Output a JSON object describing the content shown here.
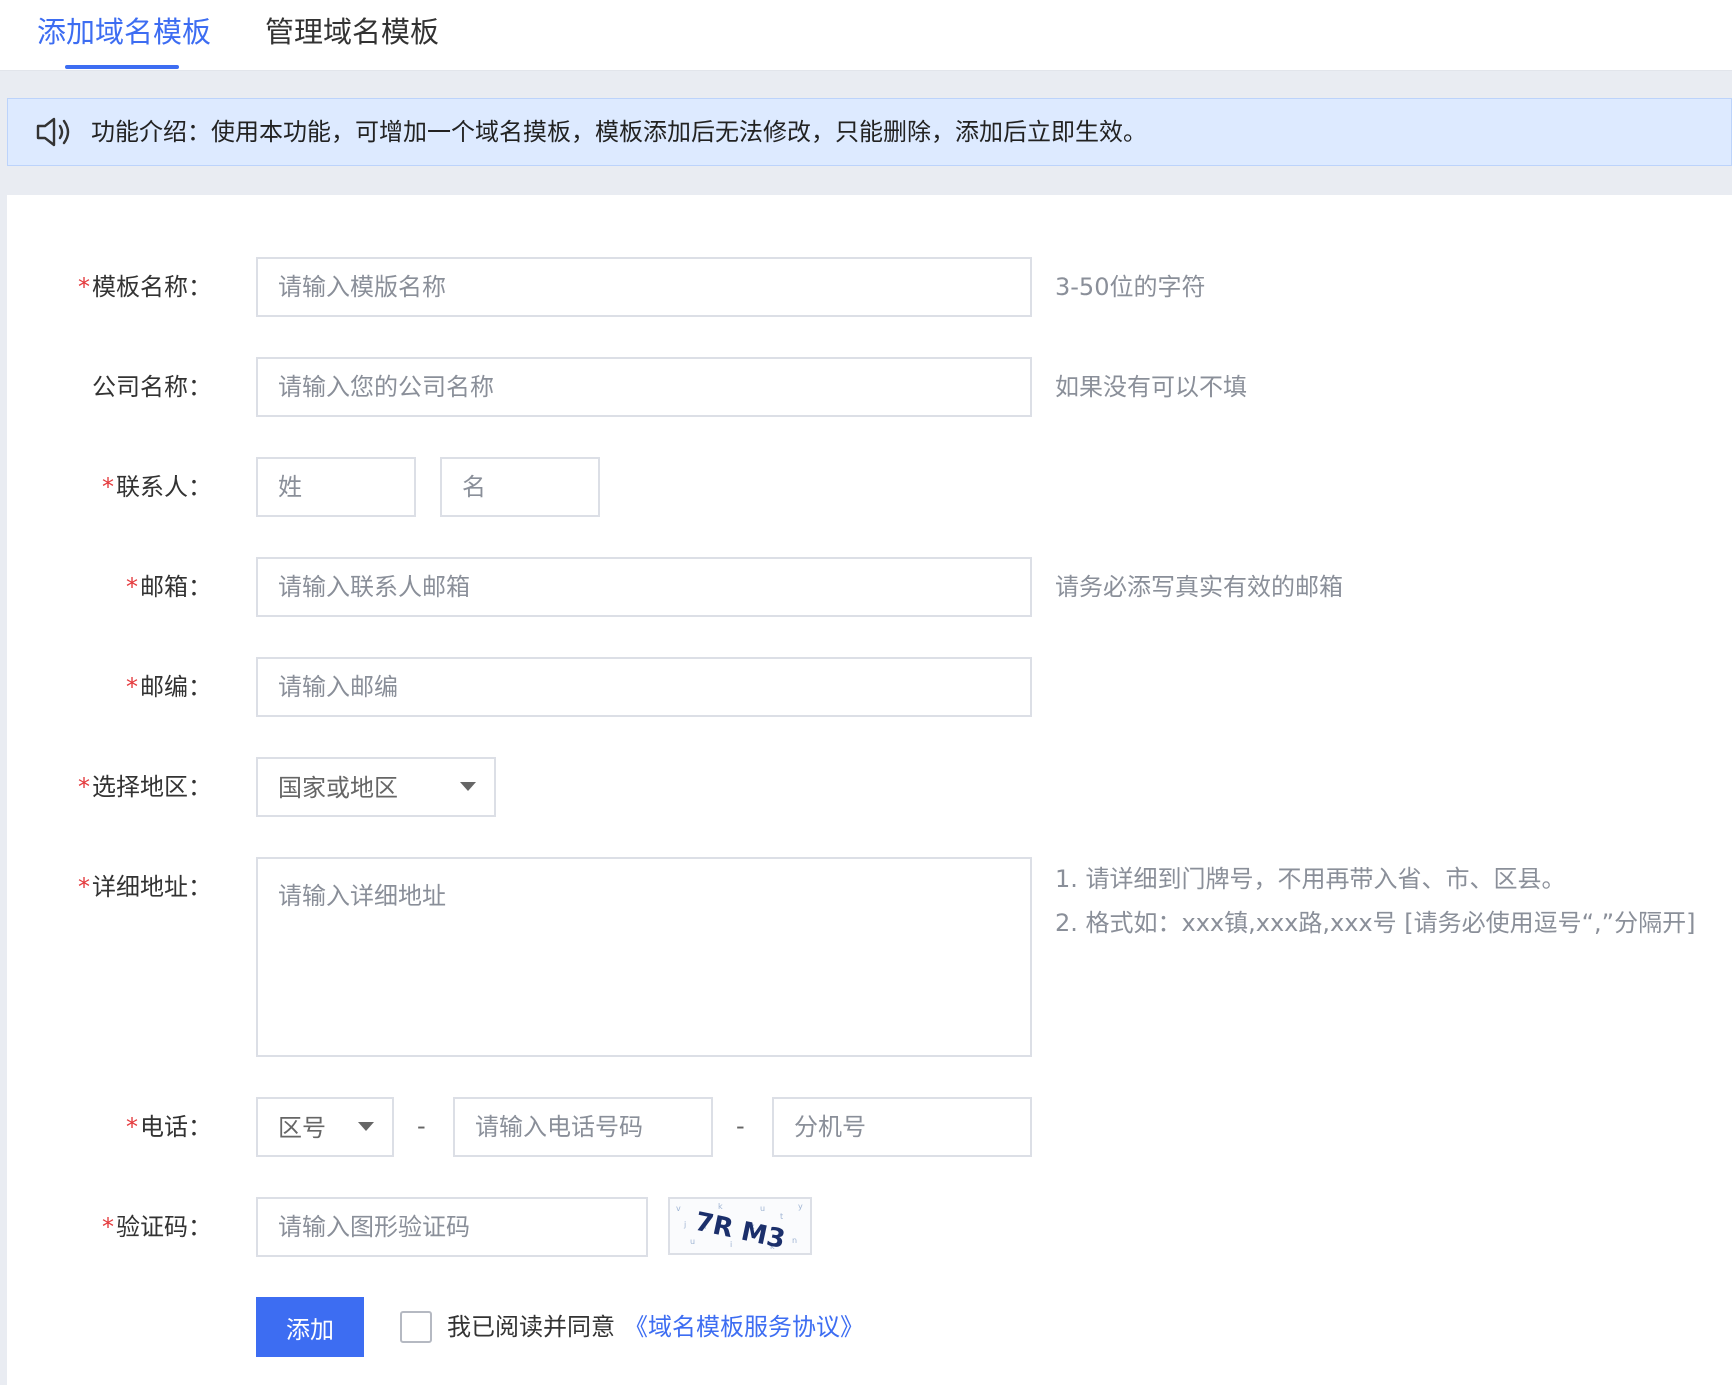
{
  "tabs": [
    {
      "label": "添加域名模板",
      "active": true
    },
    {
      "label": "管理域名模板",
      "active": false
    }
  ],
  "notice": {
    "icon": "speaker-icon",
    "text": "功能介绍：使用本功能，可增加一个域名摸板，模板添加后无法修改，只能删除，添加后立即生效。"
  },
  "form": {
    "required_mark": "*",
    "template_name": {
      "label": "模板名称：",
      "placeholder": "请输入模版名称",
      "hint": "3-50位的字符"
    },
    "company_name": {
      "label": "公司名称：",
      "placeholder": "请输入您的公司名称",
      "hint": "如果没有可以不填"
    },
    "contact": {
      "label": "联系人：",
      "surname_placeholder": "姓",
      "given_placeholder": "名"
    },
    "email": {
      "label": "邮箱：",
      "placeholder": "请输入联系人邮箱",
      "hint": "请务必添写真实有效的邮箱"
    },
    "postcode": {
      "label": "邮编：",
      "placeholder": "请输入邮编"
    },
    "region": {
      "label": "选择地区：",
      "selected": "国家或地区"
    },
    "address": {
      "label": "详细地址：",
      "placeholder": "请输入详细地址",
      "hints": [
        "1. 请详细到门牌号，不用再带入省、市、区县。",
        "2. 格式如：xxx镇,xxx路,xxx号 [请务必使用逗号“,”分隔开]"
      ]
    },
    "phone": {
      "label": "电话：",
      "area_code_selected": "区号",
      "separator": "-",
      "number_placeholder": "请输入电话号码",
      "extension_placeholder": "分机号"
    },
    "captcha": {
      "label": "验证码：",
      "placeholder": "请输入图形验证码",
      "image_text": "7R M3"
    },
    "submit_label": "添加",
    "agree_text": "我已阅读并同意",
    "agreement_link": "《域名模板服务协议》"
  },
  "colors": {
    "accent": "#3d6df2",
    "required": "#e4393c",
    "notice_bg": "#ddeaff"
  }
}
